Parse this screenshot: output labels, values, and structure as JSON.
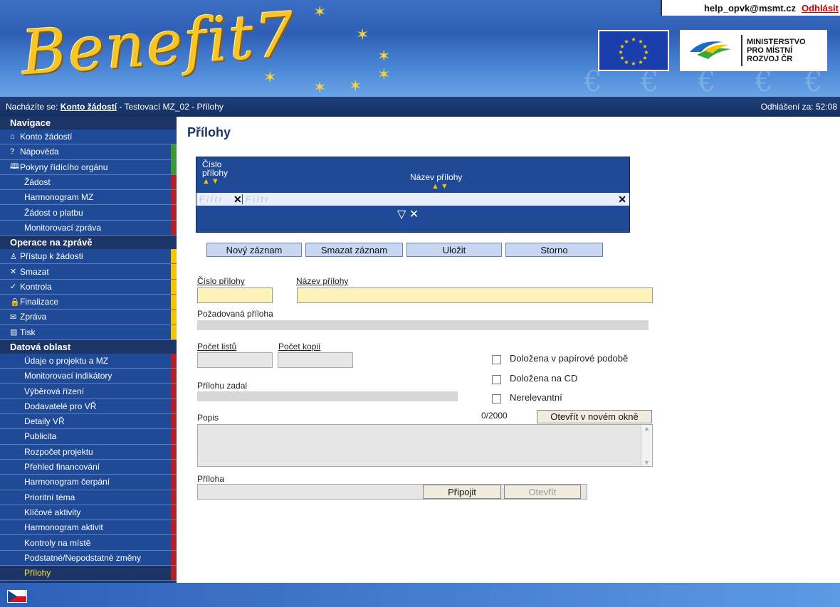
{
  "header": {
    "logo": "Benefit7",
    "user_email": "help_opvk@msmt.cz",
    "logout": "Odhlásit",
    "ministry": [
      "MINISTERSTVO",
      "PRO MÍSTNÍ",
      "ROZVOJ ČR"
    ]
  },
  "breadcrumb": {
    "prefix": "Nacházíte se:",
    "link": "Konto žádostí",
    "rest": "- Testovací MZ_02 - Přílohy",
    "timer": "Odhlášení za: 52:08"
  },
  "sidebar": {
    "nav_title": "Navigace",
    "nav": [
      {
        "icon": "home-icon",
        "glyph": "⌂",
        "label": "Konto žádostí",
        "mark": "#1f4a98"
      },
      {
        "icon": "help-icon",
        "glyph": "?",
        "label": "Nápověda",
        "mark": "#3a9a2e"
      },
      {
        "icon": "book-icon",
        "glyph": "🕮",
        "label": "Pokyny řídícího orgánu",
        "mark": "#3a9a2e"
      },
      {
        "label": "Žádost",
        "mark": "#b3202a",
        "indent": true
      },
      {
        "label": "Harmonogram MZ",
        "mark": "#b3202a",
        "indent": true
      },
      {
        "label": "Žádost o platbu",
        "mark": "#b3202a",
        "indent": true
      },
      {
        "label": "Monitorovací zpráva",
        "mark": "#b3202a",
        "indent": true
      }
    ],
    "ops_title": "Operace na zprávě",
    "ops": [
      {
        "icon": "user-icon",
        "glyph": "♙",
        "label": "Přístup k žádosti",
        "mark": "#f2c500"
      },
      {
        "icon": "delete-icon",
        "glyph": "✕",
        "label": "Smazat",
        "mark": "#f2c500"
      },
      {
        "icon": "check-icon",
        "glyph": "✓",
        "label": "Kontrola",
        "mark": "#f2c500"
      },
      {
        "icon": "lock-icon",
        "glyph": "🔒",
        "label": "Finalizace",
        "mark": "#f2c500"
      },
      {
        "icon": "mail-icon",
        "glyph": "✉",
        "label": "Zpráva",
        "mark": "#f2c500"
      },
      {
        "icon": "print-icon",
        "glyph": "▤",
        "label": "Tisk",
        "mark": "#f2c500"
      }
    ],
    "data_title": "Datová oblast",
    "data": [
      {
        "label": "Údaje o projektu a MZ"
      },
      {
        "label": "Monitorovací indikátory"
      },
      {
        "label": "Výběrová řízení"
      },
      {
        "label": "Dodavatelé pro VŘ"
      },
      {
        "label": "Detaily VŘ"
      },
      {
        "label": "Publicita"
      },
      {
        "label": "Rozpočet projektu"
      },
      {
        "label": "Přehled financování"
      },
      {
        "label": "Harmonogram čerpání"
      },
      {
        "label": "Prioritní téma"
      },
      {
        "label": "Klíčové aktivity"
      },
      {
        "label": "Harmonogram aktivit"
      },
      {
        "label": "Kontroly na místě"
      },
      {
        "label": "Podstatné/Nepodstatné změny"
      },
      {
        "label": "Přílohy",
        "active": true
      }
    ]
  },
  "main": {
    "title": "Přílohy",
    "grid": {
      "col1": [
        "Číslo",
        "přílohy"
      ],
      "col2": "Název přílohy",
      "filter_placeholder": "Filtr"
    },
    "buttons": {
      "new": "Nový záznam",
      "delete": "Smazat záznam",
      "save": "Uložit",
      "cancel": "Storno"
    },
    "form": {
      "cislo_label": "Číslo přílohy",
      "nazev_label": "Název přílohy",
      "pozadovana_label": "Požadovaná příloha",
      "pocet_listu_label": "Počet listů",
      "pocet_kopii_label": "Počet kopií",
      "zadal_label": "Přílohu zadal",
      "chk_papir": "Doložena v papírové podobě",
      "chk_cd": "Doložena na CD",
      "chk_nerelevantni": "Nerelevantní",
      "popis_label": "Popis",
      "counter": "0/2000",
      "open_window": "Otevřít v novém okně",
      "priloha_label": "Příloha",
      "attach": "Připojit",
      "open": "Otevřít"
    }
  }
}
